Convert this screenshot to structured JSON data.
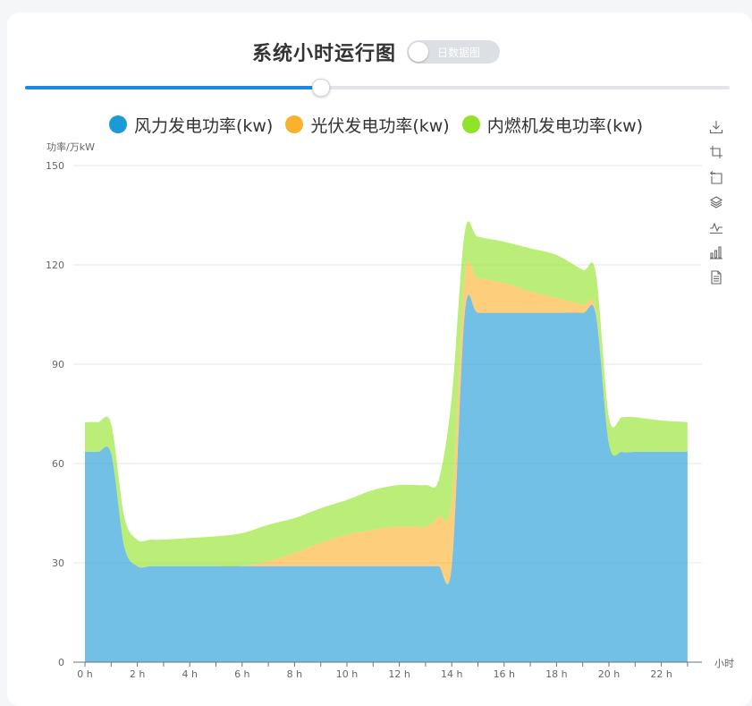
{
  "header": {
    "title": "系统小时运行图",
    "toggle_label": "日数据图",
    "toggle_on": false
  },
  "slider": {
    "value_fraction": 0.42
  },
  "legend": [
    {
      "label": "风力发电功率(kw)",
      "color": "#1b9ad6"
    },
    {
      "label": "光伏发电功率(kw)",
      "color": "#fbb12d"
    },
    {
      "label": "内燃机发电功率(kw)",
      "color": "#91e327"
    }
  ],
  "toolbox": [
    "download-icon",
    "zoom-icon",
    "zoom-reset-icon",
    "stack-icon",
    "line-chart-icon",
    "bar-chart-icon",
    "data-view-icon"
  ],
  "chart_data": {
    "type": "area",
    "stacked": true,
    "ylabel": "功率/万kW",
    "xlabel": "小时",
    "ylim": [
      0,
      150
    ],
    "yticks": [
      0,
      30,
      60,
      90,
      120,
      150
    ],
    "grid": true,
    "x_tick_labels": [
      "0 h",
      "2 h",
      "4 h",
      "6 h",
      "8 h",
      "10 h",
      "12 h",
      "14 h",
      "16 h",
      "18 h",
      "20 h",
      "22 h"
    ],
    "x": [
      0,
      0.5,
      1,
      1.5,
      2,
      2.5,
      3,
      4,
      5,
      6,
      7,
      8,
      9,
      10,
      11,
      12,
      13,
      13.5,
      14,
      14.5,
      15,
      16,
      17,
      18,
      19,
      19.5,
      20,
      20.5,
      21,
      22,
      23
    ],
    "series": [
      {
        "name": "风力发电功率(kw)",
        "color": "#1b9ad6",
        "values": [
          63.5,
          63.5,
          63,
          35,
          29,
          29,
          29,
          29,
          29,
          29,
          29,
          29,
          29,
          29,
          29,
          29,
          29,
          29,
          29,
          105.5,
          105.5,
          105.5,
          105.5,
          105.5,
          105.5,
          105,
          66,
          63.5,
          63.5,
          63.5,
          63.5
        ]
      },
      {
        "name": "光伏发电功率(kw)",
        "color": "#fbb12d",
        "values": [
          0,
          0,
          0,
          0,
          0,
          0,
          0,
          0,
          0,
          0,
          1.5,
          4,
          7,
          9.5,
          11,
          12,
          12,
          15,
          20,
          11,
          10.5,
          9,
          6.5,
          4.5,
          2.5,
          1.5,
          0,
          0,
          0,
          0,
          0
        ]
      },
      {
        "name": "内燃机发电功率(kw)",
        "color": "#91e327",
        "values": [
          9,
          9,
          9,
          9,
          8,
          8,
          8,
          8.5,
          9,
          10,
          11,
          10.5,
          10.5,
          10.5,
          12,
          12.5,
          12.5,
          11,
          31,
          13.5,
          12.5,
          12.5,
          13,
          13,
          10.5,
          11,
          8,
          10.5,
          10.5,
          9.5,
          9
        ]
      }
    ]
  }
}
